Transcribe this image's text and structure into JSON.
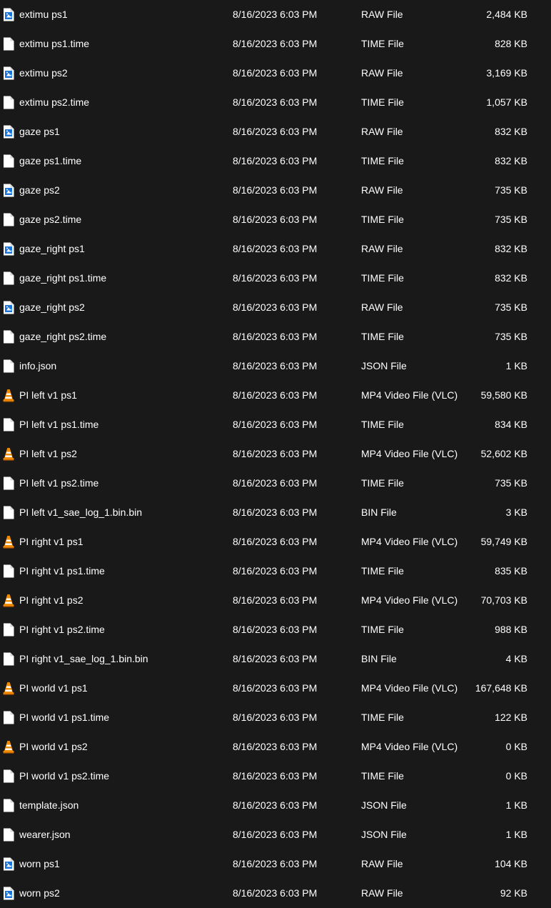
{
  "files": [
    {
      "name": "extimu ps1",
      "modified": "8/16/2023 6:03 PM",
      "type": "RAW File",
      "size": "2,484 KB",
      "icon": "raw-file-icon"
    },
    {
      "name": "extimu ps1.time",
      "modified": "8/16/2023 6:03 PM",
      "type": "TIME File",
      "size": "828 KB",
      "icon": "blank-file-icon"
    },
    {
      "name": "extimu ps2",
      "modified": "8/16/2023 6:03 PM",
      "type": "RAW File",
      "size": "3,169 KB",
      "icon": "raw-file-icon"
    },
    {
      "name": "extimu ps2.time",
      "modified": "8/16/2023 6:03 PM",
      "type": "TIME File",
      "size": "1,057 KB",
      "icon": "blank-file-icon"
    },
    {
      "name": "gaze ps1",
      "modified": "8/16/2023 6:03 PM",
      "type": "RAW File",
      "size": "832 KB",
      "icon": "raw-file-icon"
    },
    {
      "name": "gaze ps1.time",
      "modified": "8/16/2023 6:03 PM",
      "type": "TIME File",
      "size": "832 KB",
      "icon": "blank-file-icon"
    },
    {
      "name": "gaze ps2",
      "modified": "8/16/2023 6:03 PM",
      "type": "RAW File",
      "size": "735 KB",
      "icon": "raw-file-icon"
    },
    {
      "name": "gaze ps2.time",
      "modified": "8/16/2023 6:03 PM",
      "type": "TIME File",
      "size": "735 KB",
      "icon": "blank-file-icon"
    },
    {
      "name": "gaze_right ps1",
      "modified": "8/16/2023 6:03 PM",
      "type": "RAW File",
      "size": "832 KB",
      "icon": "raw-file-icon"
    },
    {
      "name": "gaze_right ps1.time",
      "modified": "8/16/2023 6:03 PM",
      "type": "TIME File",
      "size": "832 KB",
      "icon": "blank-file-icon"
    },
    {
      "name": "gaze_right ps2",
      "modified": "8/16/2023 6:03 PM",
      "type": "RAW File",
      "size": "735 KB",
      "icon": "raw-file-icon"
    },
    {
      "name": "gaze_right ps2.time",
      "modified": "8/16/2023 6:03 PM",
      "type": "TIME File",
      "size": "735 KB",
      "icon": "blank-file-icon"
    },
    {
      "name": "info.json",
      "modified": "8/16/2023 6:03 PM",
      "type": "JSON File",
      "size": "1 KB",
      "icon": "blank-file-icon"
    },
    {
      "name": "PI left v1 ps1",
      "modified": "8/16/2023 6:03 PM",
      "type": "MP4 Video File (VLC)",
      "size": "59,580 KB",
      "icon": "vlc-cone-icon"
    },
    {
      "name": "PI left v1 ps1.time",
      "modified": "8/16/2023 6:03 PM",
      "type": "TIME File",
      "size": "834 KB",
      "icon": "blank-file-icon"
    },
    {
      "name": "PI left v1 ps2",
      "modified": "8/16/2023 6:03 PM",
      "type": "MP4 Video File (VLC)",
      "size": "52,602 KB",
      "icon": "vlc-cone-icon"
    },
    {
      "name": "PI left v1 ps2.time",
      "modified": "8/16/2023 6:03 PM",
      "type": "TIME File",
      "size": "735 KB",
      "icon": "blank-file-icon"
    },
    {
      "name": "PI left v1_sae_log_1.bin.bin",
      "modified": "8/16/2023 6:03 PM",
      "type": "BIN File",
      "size": "3 KB",
      "icon": "blank-file-icon"
    },
    {
      "name": "PI right v1 ps1",
      "modified": "8/16/2023 6:03 PM",
      "type": "MP4 Video File (VLC)",
      "size": "59,749 KB",
      "icon": "vlc-cone-icon"
    },
    {
      "name": "PI right v1 ps1.time",
      "modified": "8/16/2023 6:03 PM",
      "type": "TIME File",
      "size": "835 KB",
      "icon": "blank-file-icon"
    },
    {
      "name": "PI right v1 ps2",
      "modified": "8/16/2023 6:03 PM",
      "type": "MP4 Video File (VLC)",
      "size": "70,703 KB",
      "icon": "vlc-cone-icon"
    },
    {
      "name": "PI right v1 ps2.time",
      "modified": "8/16/2023 6:03 PM",
      "type": "TIME File",
      "size": "988 KB",
      "icon": "blank-file-icon"
    },
    {
      "name": "PI right v1_sae_log_1.bin.bin",
      "modified": "8/16/2023 6:03 PM",
      "type": "BIN File",
      "size": "4 KB",
      "icon": "blank-file-icon"
    },
    {
      "name": "PI world v1 ps1",
      "modified": "8/16/2023 6:03 PM",
      "type": "MP4 Video File (VLC)",
      "size": "167,648 KB",
      "icon": "vlc-cone-icon"
    },
    {
      "name": "PI world v1 ps1.time",
      "modified": "8/16/2023 6:03 PM",
      "type": "TIME File",
      "size": "122 KB",
      "icon": "blank-file-icon"
    },
    {
      "name": "PI world v1 ps2",
      "modified": "8/16/2023 6:03 PM",
      "type": "MP4 Video File (VLC)",
      "size": "0 KB",
      "icon": "vlc-cone-icon"
    },
    {
      "name": "PI world v1 ps2.time",
      "modified": "8/16/2023 6:03 PM",
      "type": "TIME File",
      "size": "0 KB",
      "icon": "blank-file-icon"
    },
    {
      "name": "template.json",
      "modified": "8/16/2023 6:03 PM",
      "type": "JSON File",
      "size": "1 KB",
      "icon": "blank-file-icon"
    },
    {
      "name": "wearer.json",
      "modified": "8/16/2023 6:03 PM",
      "type": "JSON File",
      "size": "1 KB",
      "icon": "blank-file-icon"
    },
    {
      "name": "worn ps1",
      "modified": "8/16/2023 6:03 PM",
      "type": "RAW File",
      "size": "104 KB",
      "icon": "raw-file-icon"
    },
    {
      "name": "worn ps2",
      "modified": "8/16/2023 6:03 PM",
      "type": "RAW File",
      "size": "92 KB",
      "icon": "raw-file-icon"
    }
  ],
  "colors": {
    "background": "#191919",
    "text": "#ffffff",
    "vlc_orange": "#f08a00",
    "raw_blue": "#1a73d9"
  }
}
